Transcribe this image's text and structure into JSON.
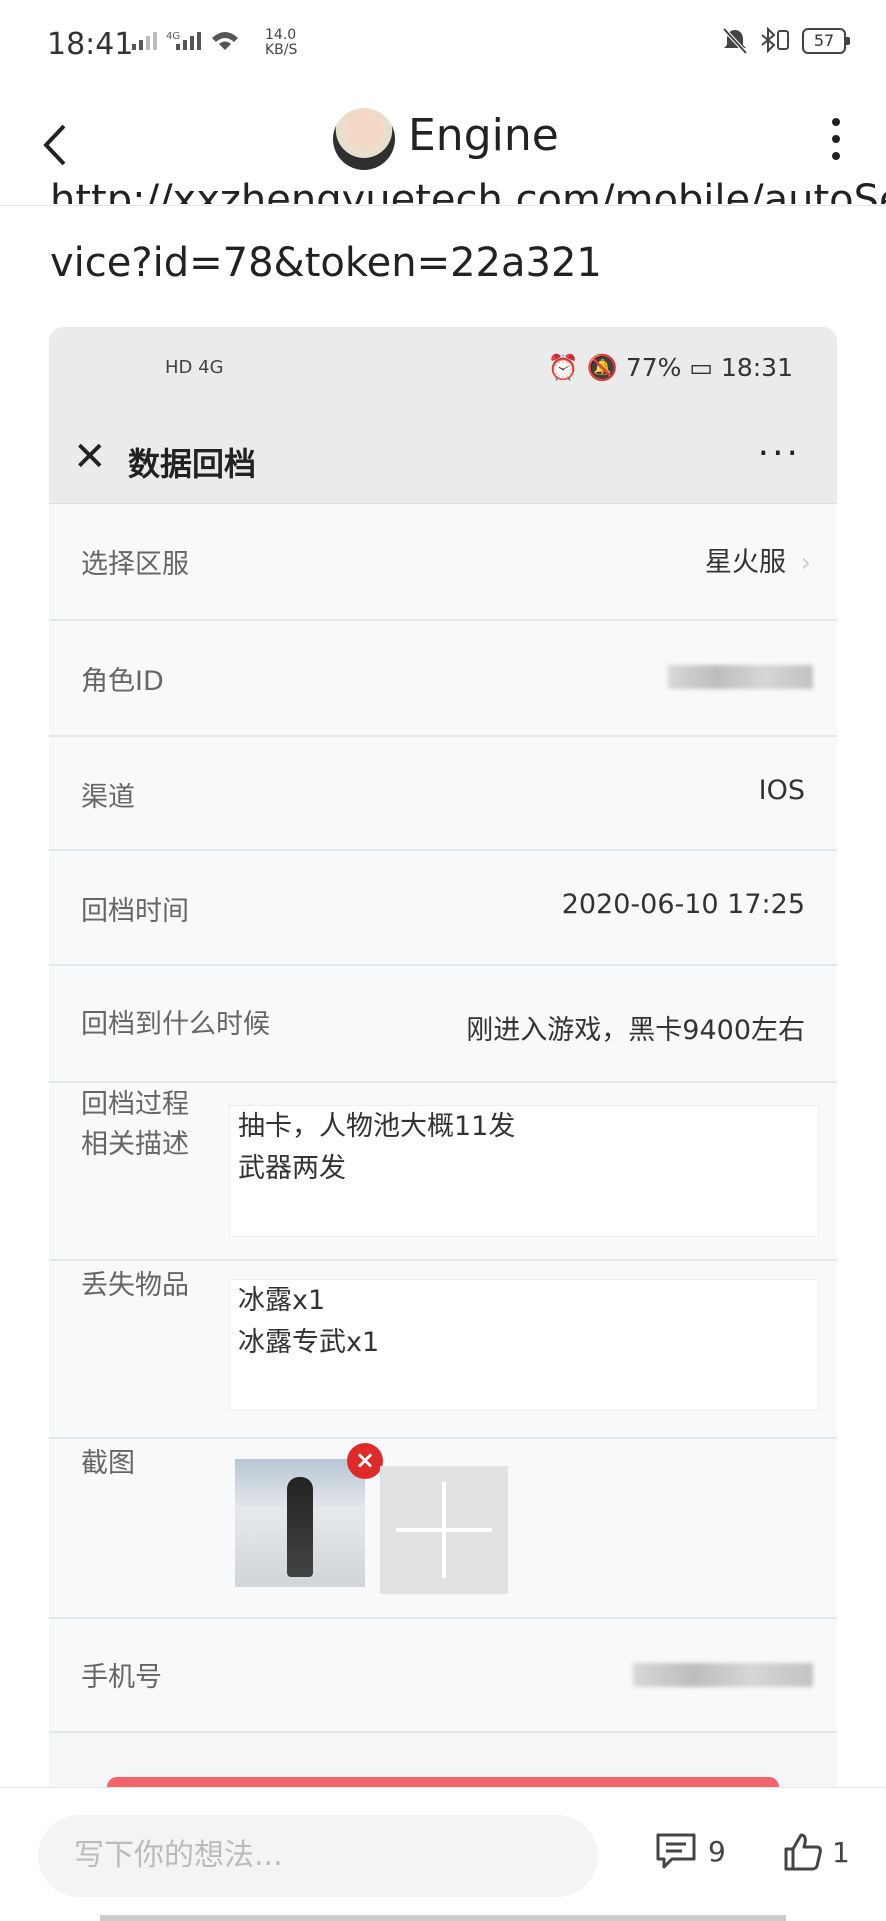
{
  "status_bar": {
    "time": "18:41",
    "signal_text": "4G",
    "net_speed_line1": "14.0",
    "net_speed_line2": "KB/S",
    "battery": "57"
  },
  "header": {
    "title": "Engine"
  },
  "post": {
    "cut_text": "http://xxzhengyuetech.com/mobile/autoSer",
    "url_tail": "vice?id=78&token=22a321"
  },
  "screenshot": {
    "status": {
      "left": "HD 4G",
      "right": "⏰ 🔕 77% ▭ 18:31"
    },
    "title": "数据回档",
    "more": "···",
    "form": {
      "server_label": "选择区服",
      "server_value": "星火服",
      "role_label": "角色ID",
      "channel_label": "渠道",
      "channel_value": "IOS",
      "rollback_time_label": "回档时间",
      "rollback_time_value": "2020-06-10 17:25",
      "rollback_to_label": "回档到什么时候",
      "rollback_to_value": "刚进入游戏，黑卡9400左右",
      "process_label_1": "回档过程",
      "process_label_2": "相关描述",
      "process_text_1": "抽卡，人物池大概11发",
      "process_text_2": "武器两发",
      "lost_label": "丢失物品",
      "lost_text_1": "冰露x1",
      "lost_text_2": "冰露专武x1",
      "screenshot_label": "截图",
      "phone_label": "手机号"
    }
  },
  "bottom_bar": {
    "comment_placeholder": "写下你的想法...",
    "comment_count": "9",
    "like_count": "1"
  }
}
